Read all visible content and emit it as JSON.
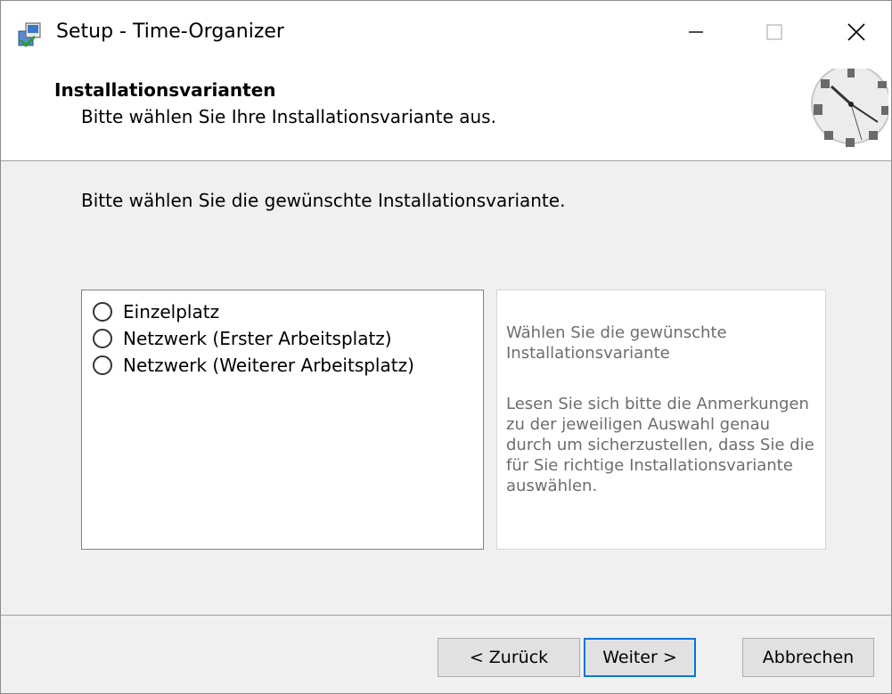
{
  "window": {
    "title": "Setup - Time-Organizer"
  },
  "header": {
    "title": "Installationsvarianten",
    "subtitle": "Bitte wählen Sie Ihre Installationsvariante aus."
  },
  "main": {
    "intro": "Bitte wählen Sie die gewünschte Installationsvariante.",
    "options": [
      {
        "label": "Einzelplatz",
        "selected": false
      },
      {
        "label": "Netzwerk (Erster Arbeitsplatz)",
        "selected": false
      },
      {
        "label": "Netzwerk (Weiterer Arbeitsplatz)",
        "selected": false
      }
    ],
    "info": {
      "para1": "Wählen Sie die gewünschte Installationsvariante",
      "para2": "Lesen Sie sich bitte die Anmerkungen zu der jeweiligen Auswahl genau durch um sicherzustellen, dass Sie die für Sie richtige Installationsvariante auswählen."
    }
  },
  "buttons": {
    "back": "< Zurück",
    "next": "Weiter >",
    "cancel": "Abbrechen"
  },
  "icons": {
    "app": "installer-icon",
    "header_graphic": "clock-icon",
    "minimize": "minimize-icon",
    "maximize": "maximize-icon",
    "close": "close-icon"
  },
  "colors": {
    "accent": "#0078d7",
    "info_text": "#6d6d6d"
  }
}
